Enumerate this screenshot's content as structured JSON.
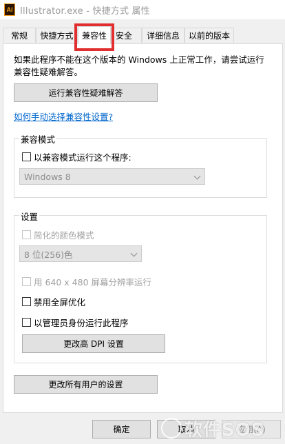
{
  "window": {
    "title": "Illustrator.exe - 快捷方式 属性",
    "icon_label": "Ai"
  },
  "tabs": [
    {
      "label": "常规"
    },
    {
      "label": "快捷方式"
    },
    {
      "label": "兼容性"
    },
    {
      "label": "安全"
    },
    {
      "label": "详细信息"
    },
    {
      "label": "以前的版本"
    }
  ],
  "intro_text": "如果此程序不能在这个版本的 Windows 上正常工作，请尝试运行兼容性疑难解答。",
  "troubleshooter_button": "运行兼容性疑难解答",
  "manual_link": "如何手动选择兼容性设置?",
  "compat_mode": {
    "group_label": "兼容模式",
    "checkbox_label": "以兼容模式运行这个程序:",
    "select_value": "Windows 8"
  },
  "settings": {
    "group_label": "设置",
    "reduced_color_label": "简化的颜色模式",
    "color_select_value": "8 位(256)色",
    "res_640_label": "用 640 x 480 屏幕分辨率运行",
    "disable_fullscreen_label": "禁用全屏优化",
    "run_as_admin_label": "以管理员身份运行此程序",
    "dpi_button": "更改高 DPI 设置"
  },
  "all_users_button": "更改所有用户的设置",
  "footer": {
    "ok": "确定",
    "cancel": "取消",
    "apply": "应用(A)"
  },
  "watermark": "软件SOS"
}
